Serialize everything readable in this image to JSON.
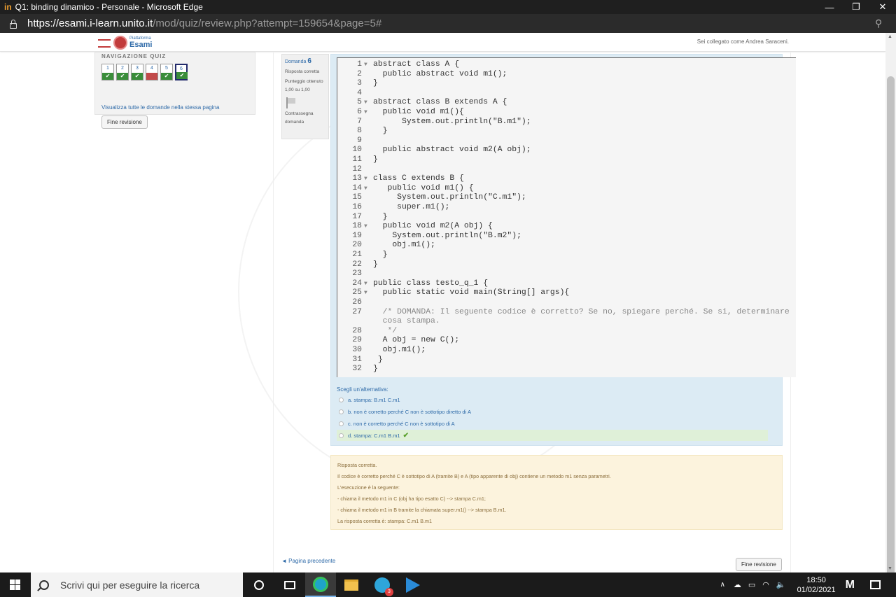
{
  "window": {
    "logo": "in",
    "title": "Q1: binding dinamico - Personale - Microsoft Edge",
    "minimize": "—",
    "restore": "❐",
    "close": "✕"
  },
  "address": {
    "host": "https://esami.i-learn.unito.it",
    "path": "/mod/quiz/review.php?attempt=159654&page=5#",
    "zoom_icon": "⚲"
  },
  "header": {
    "brand_small": "Piattaforma",
    "brand_big": "Esami",
    "logged_in": "Sei collegato come Andrea Saraceni."
  },
  "quiz_nav": {
    "title": "NAVIGAZIONE QUIZ",
    "buttons": [
      {
        "num": "1",
        "mark": "✔"
      },
      {
        "num": "2",
        "mark": "✔"
      },
      {
        "num": "3",
        "mark": "✔"
      },
      {
        "num": "4",
        "mark": ""
      },
      {
        "num": "5",
        "mark": "✔"
      },
      {
        "num": "6",
        "mark": "✔"
      }
    ],
    "show_all": "Visualizza tutte le domande nella stessa pagina",
    "finish": "Fine revisione"
  },
  "question_info": {
    "label": "Domanda",
    "number": "6",
    "state": "Risposta corretta",
    "grade": "Punteggio ottenuto 1,00 su 1,00",
    "flag": "Contrassegna domanda"
  },
  "code_lines": [
    {
      "n": "1",
      "fold": "▼",
      "text": "abstract class A {"
    },
    {
      "n": "2",
      "fold": "",
      "text": "  public abstract void m1();"
    },
    {
      "n": "3",
      "fold": "",
      "text": "}"
    },
    {
      "n": "4",
      "fold": "",
      "text": ""
    },
    {
      "n": "5",
      "fold": "▼",
      "text": "abstract class B extends A {"
    },
    {
      "n": "6",
      "fold": "▼",
      "text": "  public void m1(){"
    },
    {
      "n": "7",
      "fold": "",
      "text": "      System.out.println(\"B.m1\");"
    },
    {
      "n": "8",
      "fold": "",
      "text": "  }"
    },
    {
      "n": "9",
      "fold": "",
      "text": ""
    },
    {
      "n": "10",
      "fold": "",
      "text": "  public abstract void m2(A obj);"
    },
    {
      "n": "11",
      "fold": "",
      "text": "}"
    },
    {
      "n": "12",
      "fold": "",
      "text": ""
    },
    {
      "n": "13",
      "fold": "▼",
      "text": "class C extends B {"
    },
    {
      "n": "14",
      "fold": "▼",
      "text": "   public void m1() {"
    },
    {
      "n": "15",
      "fold": "",
      "text": "     System.out.println(\"C.m1\");"
    },
    {
      "n": "16",
      "fold": "",
      "text": "     super.m1();"
    },
    {
      "n": "17",
      "fold": "",
      "text": "  }"
    },
    {
      "n": "18",
      "fold": "▼",
      "text": "  public void m2(A obj) {"
    },
    {
      "n": "19",
      "fold": "",
      "text": "    System.out.println(\"B.m2\");"
    },
    {
      "n": "20",
      "fold": "",
      "text": "    obj.m1();"
    },
    {
      "n": "21",
      "fold": "",
      "text": "  }"
    },
    {
      "n": "22",
      "fold": "",
      "text": "}"
    },
    {
      "n": "23",
      "fold": "",
      "text": ""
    },
    {
      "n": "24",
      "fold": "▼",
      "text": "public class testo_q_1 {"
    },
    {
      "n": "25",
      "fold": "▼",
      "text": "  public static void main(String[] args){"
    },
    {
      "n": "26",
      "fold": "",
      "text": ""
    },
    {
      "n": "27",
      "fold": "",
      "text": "  /* DOMANDA: Il seguente codice è corretto? Se no, spiegare perché. Se si, determinare"
    },
    {
      "n": "",
      "fold": "",
      "text": "  cosa stampa."
    },
    {
      "n": "28",
      "fold": "",
      "text": "   */"
    },
    {
      "n": "29",
      "fold": "",
      "text": "  A obj = new C();"
    },
    {
      "n": "30",
      "fold": "",
      "text": "  obj.m1();"
    },
    {
      "n": "31",
      "fold": "",
      "text": " }"
    },
    {
      "n": "32",
      "fold": "",
      "text": "}"
    }
  ],
  "answers": {
    "prompt": "Scegli un'alternativa:",
    "options": [
      {
        "text": "a. stampa: B.m1 C.m1",
        "correct": ""
      },
      {
        "text": "b. non è corretto perché C non è sottotipo diretto di A",
        "correct": ""
      },
      {
        "text": "c. non è corretto perché C non è sottotipo di A",
        "correct": ""
      },
      {
        "text": "d. stampa: C.m1 B.m1",
        "correct": "✔"
      }
    ]
  },
  "feedback": {
    "lines": [
      "Risposta corretta.",
      "Il codice è corretto perché C è sottotipo di A (tramite B) e A (tipo apparente di obj) contiene un metodo m1 senza parametri.",
      "L'esecuzione è la seguente:",
      "- chiama il metodo m1 in C (obj ha tipo esatto C) --> stampa C.m1;",
      "- chiama il metodo m1 in B tramite la chiamata super.m1() --> stampa B.m1.",
      "La risposta corretta è: stampa: C.m1 B.m1"
    ]
  },
  "footer": {
    "prev": "◄ Pagina precedente",
    "finish": "Fine revisione"
  },
  "scrollbar": {
    "up": "▲",
    "down": "▼"
  },
  "taskbar": {
    "search_placeholder": "Scrivi qui per eseguire la ricerca",
    "telegram_badge": "3",
    "tray_arrow": "∧",
    "cloud": "☁",
    "battery": "▭",
    "wifi": "◠",
    "volume": "🔈",
    "time": "18:50",
    "date": "01/02/2021",
    "app_mark": "M"
  }
}
